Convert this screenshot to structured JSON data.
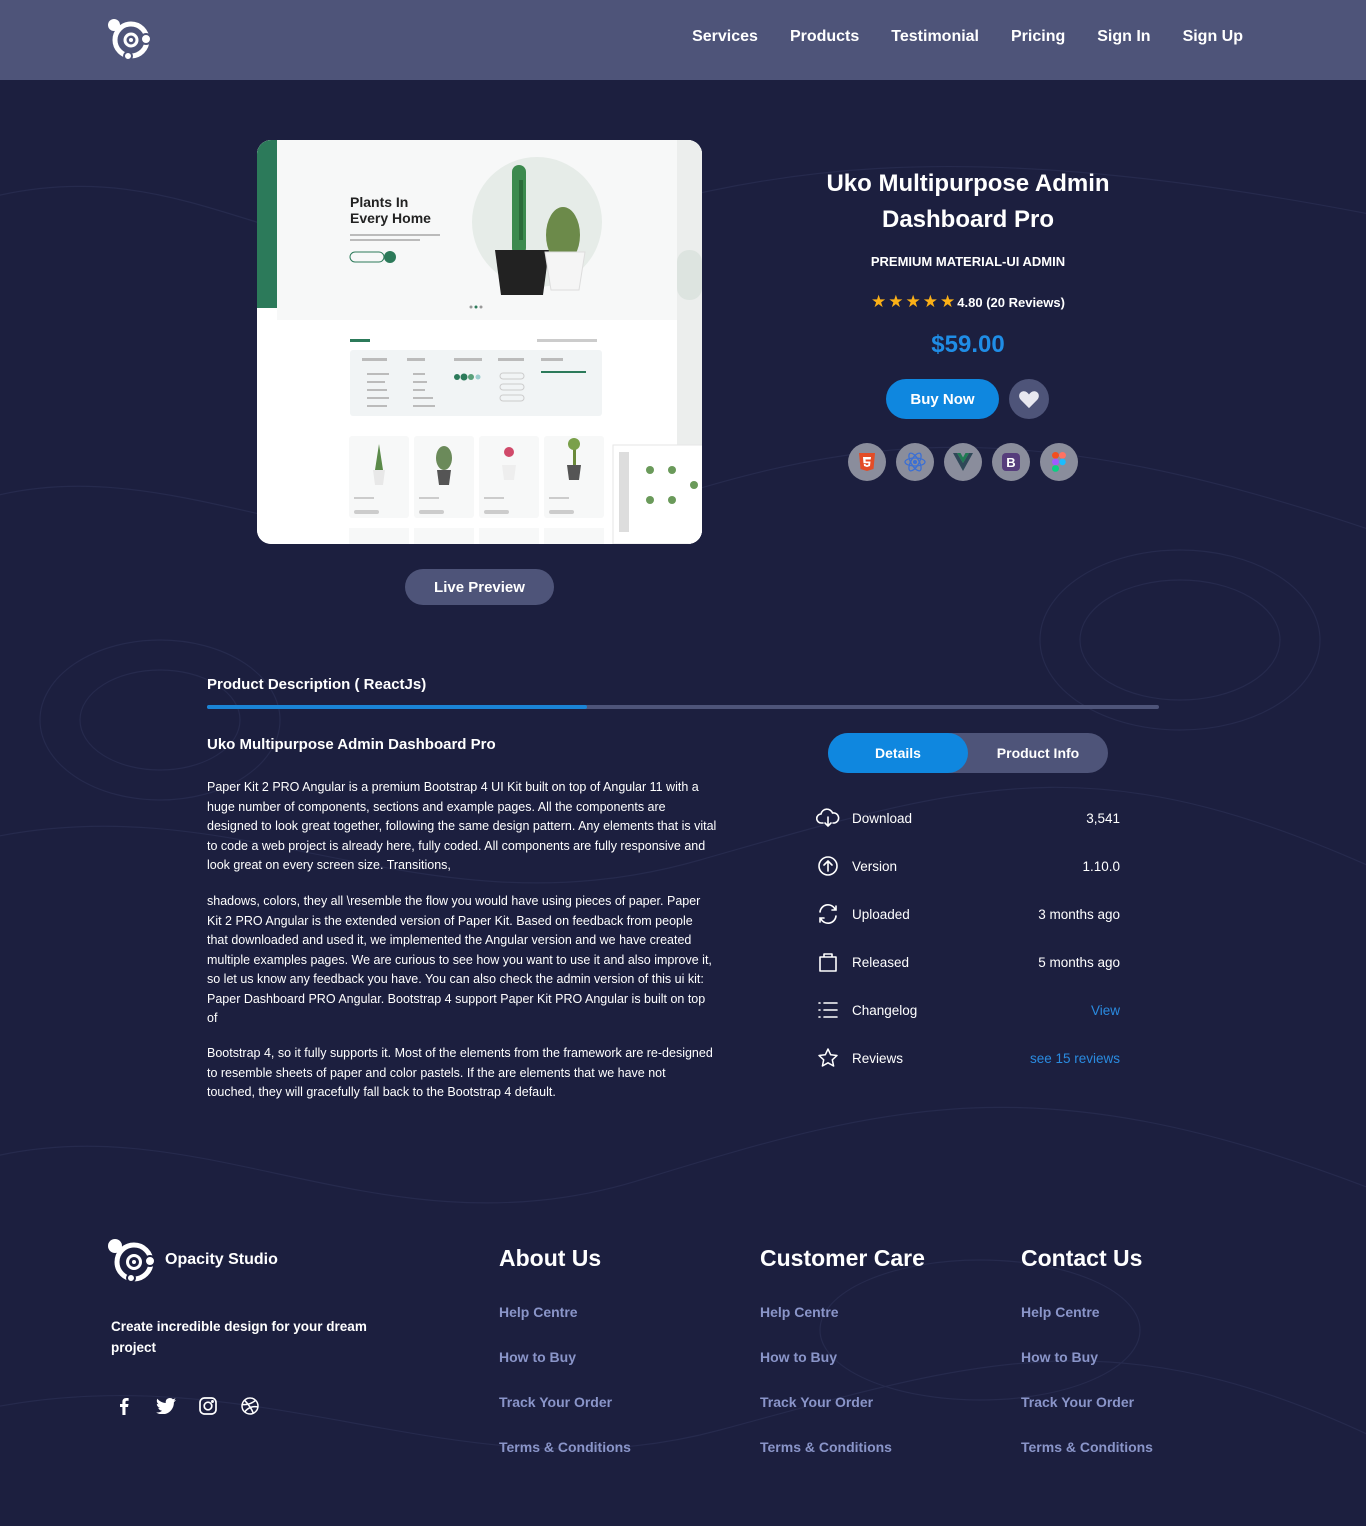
{
  "nav": {
    "links": [
      "Services",
      "Products",
      "Testimonial",
      "Pricing",
      "Sign In",
      "Sign Up"
    ]
  },
  "preview": {
    "headline_line1": "Plants In",
    "headline_line2": "Every Home",
    "live_preview_label": "Live Preview"
  },
  "product": {
    "title": "Uko Multipurpose Admin Dashboard Pro",
    "subtitle": "PREMIUM MATERIAL-UI ADMIN",
    "rating_text": "4.80 (20 Reviews)",
    "stars": 5,
    "price": "$59.00",
    "buy_label": "Buy Now",
    "tech_icons": [
      "html5-icon",
      "react-icon",
      "vue-icon",
      "bootstrap-icon",
      "figma-icon"
    ]
  },
  "description": {
    "tab_title": "Product Description ( ReactJs)",
    "heading": "Uko Multipurpose Admin Dashboard Pro",
    "para1": "Paper Kit 2 PRO Angular is a premium Bootstrap 4 UI Kit built on top of Angular 11 with a huge number of components, sections and example pages. All the components are designed to look great together, following the same design pattern. Any elements that is vital to code a web project is already here, fully coded. All components are fully responsive and look great on every screen size. Transitions,",
    "para2": "shadows, colors, they all \\resemble the flow you would have using pieces of paper. Paper Kit 2 PRO Angular is the extended version of Paper Kit. Based on feedback from people that downloaded and used it, we implemented the Angular version and we have created multiple examples pages. We are curious to see how you want to use it and also improve it, so let us know any feedback you have. You can also check the admin version of this ui kit: Paper Dashboard PRO Angular. Bootstrap 4 support Paper Kit PRO Angular is built on top of",
    "para3": "Bootstrap 4, so it fully supports it. Most of the elements from the framework are re-designed to resemble sheets of paper and color pastels. If the are elements that we have not touched, they will gracefully fall back to the Bootstrap 4 default."
  },
  "details": {
    "tab_details": "Details",
    "tab_info": "Product Info",
    "rows": [
      {
        "icon": "cloud-download-icon",
        "label": "Download",
        "value": "3,541"
      },
      {
        "icon": "arrow-up-circle-icon",
        "label": "Version",
        "value": "1.10.0"
      },
      {
        "icon": "refresh-icon",
        "label": "Uploaded",
        "value": "3 months ago"
      },
      {
        "icon": "bag-icon",
        "label": "Released",
        "value": "5 months ago"
      },
      {
        "icon": "list-icon",
        "label": "Changelog",
        "value": "View"
      },
      {
        "icon": "star-outline-icon",
        "label": "Reviews",
        "value": "see 15 reviews"
      }
    ]
  },
  "footer": {
    "brand": "Opacity Studio",
    "tagline": "Create incredible design for your dream project",
    "columns": [
      {
        "title": "About Us",
        "links": [
          "Help Centre",
          "How to Buy",
          "Track Your Order",
          "Terms & Conditions"
        ]
      },
      {
        "title": "Customer Care",
        "links": [
          "Help Centre",
          "How to Buy",
          "Track Your Order",
          "Terms & Conditions"
        ]
      },
      {
        "title": "Contact Us",
        "links": [
          "Help Centre",
          "How to Buy",
          "Track Your Order",
          "Terms & Conditions"
        ]
      }
    ]
  },
  "colors": {
    "background": "#1c1f3f",
    "nav": "#4e5479",
    "accent": "#0f87df",
    "star": "#fbb017",
    "footer_link": "#8a95c9"
  }
}
